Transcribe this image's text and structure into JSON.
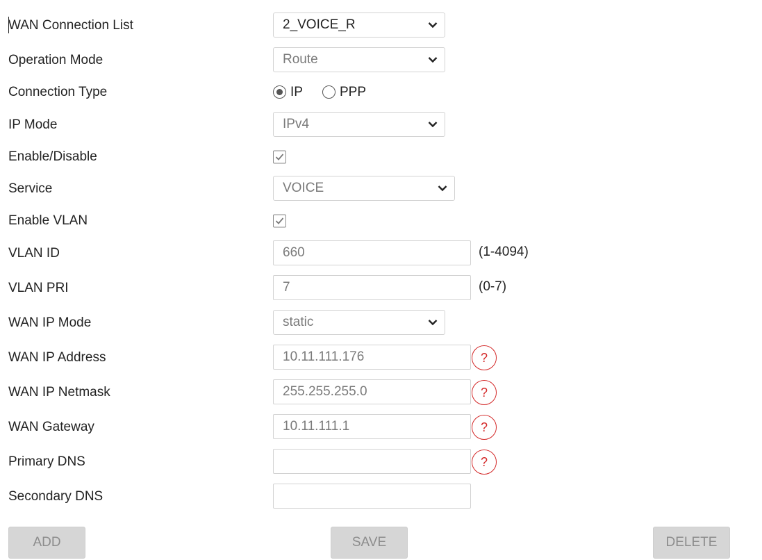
{
  "form": {
    "wan_connection_list": {
      "label": "WAN Connection List",
      "value": "2_VOICE_R"
    },
    "operation_mode": {
      "label": "Operation Mode",
      "value": "Route"
    },
    "connection_type": {
      "label": "Connection Type",
      "options": [
        {
          "label": "IP",
          "checked": true
        },
        {
          "label": "PPP",
          "checked": false
        }
      ]
    },
    "ip_mode": {
      "label": "IP Mode",
      "value": "IPv4"
    },
    "enable_disable": {
      "label": "Enable/Disable",
      "checked": true
    },
    "service": {
      "label": "Service",
      "value": "VOICE"
    },
    "enable_vlan": {
      "label": "Enable VLAN",
      "checked": true
    },
    "vlan_id": {
      "label": "VLAN ID",
      "value": "660",
      "hint": "(1-4094)"
    },
    "vlan_pri": {
      "label": "VLAN PRI",
      "value": "7",
      "hint": "(0-7)"
    },
    "wan_ip_mode": {
      "label": "WAN IP Mode",
      "value": "static"
    },
    "wan_ip_address": {
      "label": "WAN IP Address",
      "value": "10.11.111.176",
      "help": "?"
    },
    "wan_ip_netmask": {
      "label": "WAN IP Netmask",
      "value": "255.255.255.0",
      "help": "?"
    },
    "wan_gateway": {
      "label": "WAN Gateway",
      "value": "10.11.111.1",
      "help": "?"
    },
    "primary_dns": {
      "label": "Primary DNS",
      "value": "",
      "help": "?"
    },
    "secondary_dns": {
      "label": "Secondary DNS",
      "value": ""
    }
  },
  "buttons": {
    "add": "ADD",
    "save": "SAVE",
    "delete": "DELETE"
  },
  "colors": {
    "help_accent": "#d42a2a",
    "button_bg": "#d6d6d6",
    "button_text": "#8c8c8c"
  },
  "icons": {
    "select_arrow": "chevron-down-icon",
    "check": "checkmark-icon",
    "help": "help-icon"
  }
}
